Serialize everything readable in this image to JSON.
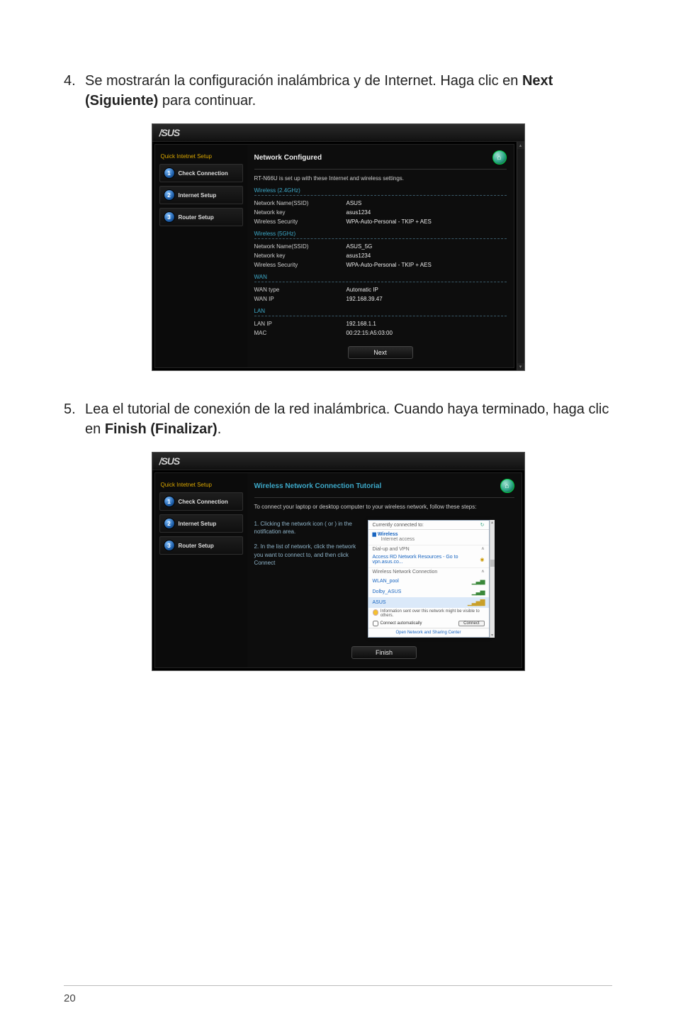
{
  "steps": {
    "s4": {
      "num": "4.",
      "text_a": "Se mostrarán la configuración inalámbrica y de Internet. Haga clic en ",
      "text_b": "Next (Siguiente)",
      "text_c": " para continuar."
    },
    "s5": {
      "num": "5.",
      "text_a": "Lea el tutorial de conexión de la red inalámbrica. Cuando haya terminado, haga clic en ",
      "text_b": "Finish (Finalizar)",
      "text_c": "."
    }
  },
  "brand": "/SUS",
  "sidebar": {
    "title": "Quick Intetnet Setup",
    "items": [
      {
        "num": "1",
        "label": "Check Connection"
      },
      {
        "num": "2",
        "label": "Internet Setup"
      },
      {
        "num": "3",
        "label": "Router Setup"
      }
    ]
  },
  "shot1": {
    "title": "Network Configured",
    "intro": "RT-N66U is set up with these Internet and wireless settings.",
    "sections": [
      {
        "head": "Wireless (2.4GHz)",
        "rows": [
          {
            "k": "Network Name(SSID)",
            "v": "ASUS"
          },
          {
            "k": "Network key",
            "v": "asus1234"
          },
          {
            "k": "Wireless Security",
            "v": "WPA-Auto-Personal - TKIP + AES"
          }
        ]
      },
      {
        "head": "Wireless (5GHz)",
        "rows": [
          {
            "k": "Network Name(SSID)",
            "v": "ASUS_5G"
          },
          {
            "k": "Network key",
            "v": "asus1234"
          },
          {
            "k": "Wireless Security",
            "v": "WPA-Auto-Personal - TKIP + AES"
          }
        ]
      },
      {
        "head": "WAN",
        "rows": [
          {
            "k": "WAN type",
            "v": "Automatic IP"
          },
          {
            "k": "WAN IP",
            "v": "192.168.39.47"
          }
        ]
      },
      {
        "head": "LAN",
        "rows": [
          {
            "k": "LAN IP",
            "v": "192.168.1.1"
          },
          {
            "k": "MAC",
            "v": "00:22:15:A5:03:00"
          }
        ]
      }
    ],
    "button": "Next"
  },
  "shot2": {
    "title": "Wireless Network Connection Tutorial",
    "intro": "To connect your laptop or desktop computer to your wireless network, follow these steps:",
    "left": {
      "l1": "1. Clicking the network icon ( or ) in the notification area.",
      "l2": "2. In the list of network, click the network you want to connect to, and then click Connect"
    },
    "popup": {
      "currently": "Currently connected to:",
      "conn_name": "Wireless",
      "conn_sub": "Internet access",
      "dialup": "Dial-up and VPN",
      "vpn_entry": "Access RD Network Resources - Go to vpn.asus.co...",
      "sec": "Wireless Network Connection",
      "nets": [
        {
          "n": "WLAN_pool"
        },
        {
          "n": "Dolby_ASUS"
        },
        {
          "n": "ASUS"
        }
      ],
      "warn": "Information sent over this network might be visible to others.",
      "auto": "Connect automatically",
      "connect": "Connect",
      "footer": "Open Network and Sharing Center"
    },
    "button": "Finish"
  },
  "page_number": "20"
}
